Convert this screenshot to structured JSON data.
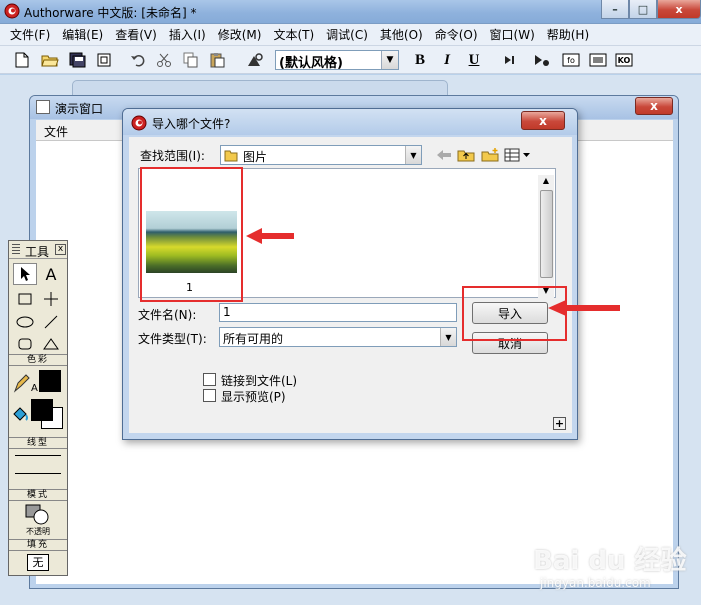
{
  "app": {
    "title": "Authorware 中文版: [未命名] *",
    "window_buttons": {
      "minimize": "–",
      "maximize": "□",
      "close": "x"
    }
  },
  "menubar": {
    "items": [
      "文件(F)",
      "编辑(E)",
      "查看(V)",
      "插入(I)",
      "修改(M)",
      "文本(T)",
      "调试(C)",
      "其他(O)",
      "命令(O)",
      "窗口(W)",
      "帮助(H)"
    ]
  },
  "toolbar": {
    "icons": [
      "new-icon",
      "open-icon",
      "save-all-icon",
      "import-icon",
      "undo-icon",
      "cut-icon",
      "copy-icon",
      "paste-icon",
      "find-icon"
    ],
    "style_select": {
      "value": "(默认风格)"
    },
    "format_buttons": [
      "B",
      "I",
      "U"
    ],
    "right_icons": [
      "restart-icon",
      "control-panel-icon",
      "functions-icon",
      "variables-icon",
      "knowledge-objects-icon"
    ],
    "right_labels": [
      "fo",
      "KO"
    ]
  },
  "presentation_window": {
    "title": "演示窗口",
    "menu_file": "文件",
    "close": "x"
  },
  "tools": {
    "title": "工具",
    "close": "x",
    "text_tool": "A",
    "color_section": "色彩",
    "color_label": "A",
    "line_section": "线型",
    "mode_section": "模式",
    "mode_value": "不透明",
    "fill_section": "填充",
    "fill_value": "无"
  },
  "dialog": {
    "title": "导入哪个文件?",
    "close": "x",
    "look_in_label": "查找范围(I):",
    "look_in_value": "图片",
    "file_items": [
      {
        "name": "1"
      }
    ],
    "filename_label": "文件名(N):",
    "filename_value": "1",
    "filetype_label": "文件类型(T):",
    "filetype_value": "所有可用的",
    "import_button": "导入",
    "cancel_button": "取消",
    "link_checkbox": "链接到文件(L)",
    "preview_checkbox": "显示预览(P)",
    "expand_button": "+"
  },
  "colors": {
    "annotation_red": "#e52d2d"
  },
  "watermark": {
    "brand": "Bai du 经验",
    "url": "jingyan.baidu.com"
  }
}
